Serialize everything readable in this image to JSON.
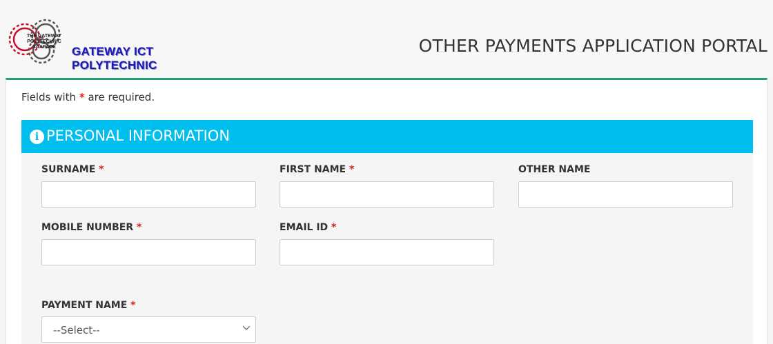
{
  "header": {
    "logo_name": "GATEWAY ICT POLYTECHNIC",
    "logo_seal_line1": "THE GATEWAY",
    "logo_seal_line2": "POLYTECHNIC",
    "logo_seal_line3": "SAAPADE",
    "portal_title": "OTHER PAYMENTS APPLICATION PORTAL"
  },
  "form": {
    "required_note_prefix": "Fields with",
    "required_marker": "*",
    "required_note_suffix": "are required.",
    "section_title": "PERSONAL INFORMATION",
    "fields": {
      "surname": {
        "label": "SURNAME",
        "required": "*",
        "value": ""
      },
      "first_name": {
        "label": "FIRST NAME",
        "required": "*",
        "value": ""
      },
      "other_name": {
        "label": "OTHER NAME",
        "value": ""
      },
      "mobile": {
        "label": "MOBILE NUMBER",
        "required": "*",
        "value": ""
      },
      "email": {
        "label": "EMAIL ID",
        "required": "*",
        "value": ""
      },
      "payment_name": {
        "label": "PAYMENT NAME",
        "required": "*",
        "selected": "--Select--"
      }
    }
  },
  "colors": {
    "accent_bar": "#2a9d6f",
    "panel_header": "#00bfee",
    "required": "#d9230f",
    "logo_text": "#1a1ab8"
  }
}
